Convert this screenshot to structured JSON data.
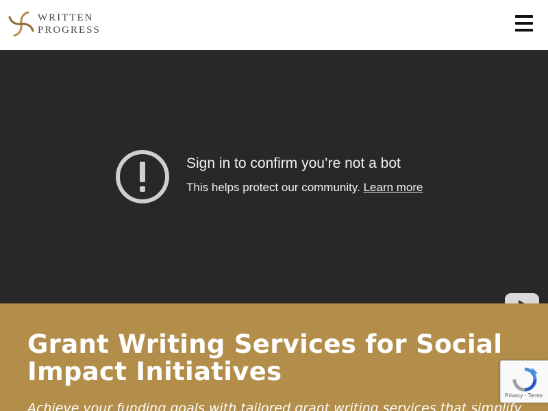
{
  "header": {
    "logo": {
      "line1": "WRITTEN",
      "line2": "PROGRESS",
      "icon": "feather-swirl-logo"
    },
    "menu_icon": "hamburger-menu-icon"
  },
  "video_embed": {
    "title": "Sign in to confirm you’re not a bot",
    "message": "This helps protect our community.",
    "link_text": "Learn more",
    "icon": "alert-circle-icon",
    "brand_icon": "youtube-logo-icon"
  },
  "hero": {
    "title": "Grant Writing Services for Social Impact Initiatives",
    "subtitle": "Achieve your funding goals with tailored grant writing services that simplify"
  },
  "recaptcha": {
    "links": "Privacy - Terms",
    "icon": "recaptcha-icon"
  },
  "colors": {
    "hero_bg": "#b38e4b",
    "video_bg": "#282828",
    "logo_gold": "#b38e4b"
  }
}
